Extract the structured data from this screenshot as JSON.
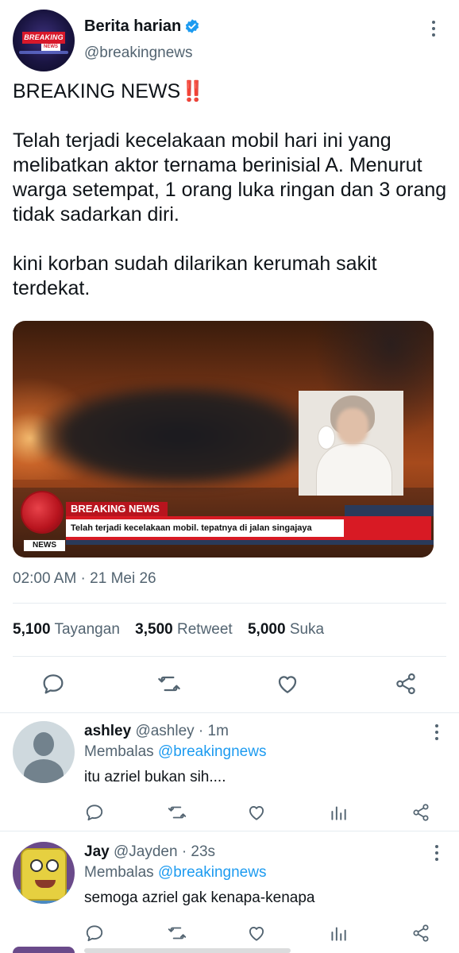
{
  "tweet": {
    "author": {
      "display_name": "Berita harian",
      "handle": "@breakingnews",
      "verified": true,
      "avatar_text_top": "BREAKING",
      "avatar_text_bottom": "NEWS"
    },
    "text_heading": "BREAKING NEWS",
    "heading_emoji": "‼️",
    "text_paragraph_1": "Telah terjadi kecelakaan mobil hari ini yang melibatkan aktor ternama berinisial A. Menurut warga setempat, 1 orang luka ringan dan 3 orang tidak sadarkan diri.",
    "text_paragraph_2": "kini korban sudah dilarikan kerumah sakit terdekat.",
    "media": {
      "ticker_label": "BREAKING NEWS",
      "ticker_text": "Telah terjadi kecelakaan mobil. tepatnya di jalan singajaya",
      "news_label": "NEWS"
    },
    "timestamp": "02:00 AM · 21 Mei 26",
    "stats": {
      "views_count": "5,100",
      "views_label": "Tayangan",
      "retweets_count": "3,500",
      "retweets_label": "Retweet",
      "likes_count": "5,000",
      "likes_label": "Suka"
    }
  },
  "replies": [
    {
      "name": "ashley",
      "handle": "@ashley · 1m",
      "replying_prefix": "Membalas",
      "replying_to": "@breakingnews",
      "text": "itu azriel bukan sih...."
    },
    {
      "name": "Jay",
      "handle": "@Jayden · 23s",
      "replying_prefix": "Membalas",
      "replying_to": "@breakingnews",
      "text": "semoga azriel gak kenapa-kenapa"
    }
  ],
  "colors": {
    "accent": "#1d9bf0",
    "text": "#0f1419",
    "muted": "#536471",
    "alert": "#e0245e"
  },
  "icons": [
    "more-vertical-icon",
    "verified-badge-icon",
    "reply-icon",
    "retweet-icon",
    "like-icon",
    "share-icon",
    "analytics-icon"
  ]
}
